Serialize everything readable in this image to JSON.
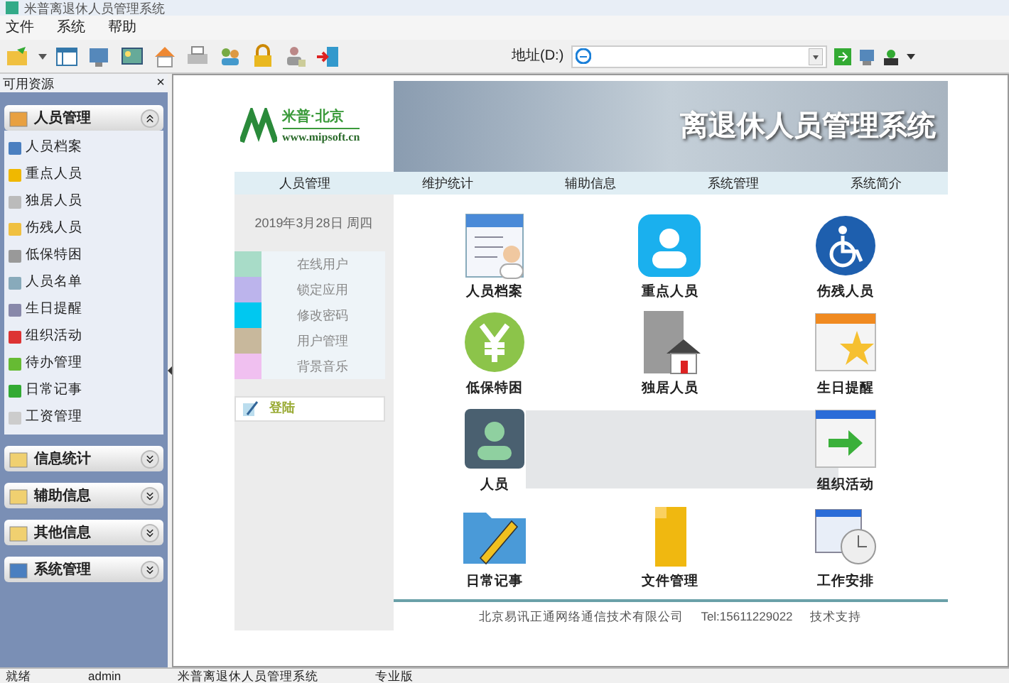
{
  "window": {
    "title": "米普离退休人员管理系统"
  },
  "menu": [
    "文件",
    "系统",
    "帮助"
  ],
  "address": {
    "label": "地址(D:)"
  },
  "sidebar": {
    "title": "可用资源",
    "close": "×",
    "groups": [
      {
        "label": "人员管理",
        "expanded": true,
        "items": [
          "人员档案",
          "重点人员",
          "独居人员",
          "伤残人员",
          "低保特困",
          "人员名单",
          "生日提醒",
          "组织活动",
          "待办管理",
          "日常记事",
          "工资管理"
        ]
      },
      {
        "label": "信息统计",
        "expanded": false
      },
      {
        "label": "辅助信息",
        "expanded": false
      },
      {
        "label": "其他信息",
        "expanded": false
      },
      {
        "label": "系统管理",
        "expanded": false
      }
    ]
  },
  "page": {
    "logo": {
      "name": "米普·北京",
      "url": "www.mipsoft.cn"
    },
    "banner_title": "离退休人员管理系统",
    "nav": [
      "人员管理",
      "维护统计",
      "辅助信息",
      "系统管理",
      "系统简介"
    ],
    "date": "2019年3月28日 周四",
    "quick_links": [
      {
        "label": "在线用户",
        "color": "#a8dcc8"
      },
      {
        "label": "锁定应用",
        "color": "#bcb4ec"
      },
      {
        "label": "修改密码",
        "color": "#00c8f0"
      },
      {
        "label": "用户管理",
        "color": "#c8b89c"
      },
      {
        "label": "背景音乐",
        "color": "#f0c0f0"
      }
    ],
    "login": "登陆",
    "tiles": [
      "人员档案",
      "重点人员",
      "伤残人员",
      "低保特困",
      "独居人员",
      "生日提醒",
      "人员",
      "组织活动",
      "日常记事",
      "文件管理",
      "工作安排"
    ],
    "footer": [
      "北京易讯正通网络通信技术有限公司",
      "Tel:15611229022",
      "技术支持"
    ]
  },
  "status_bar": [
    "就绪",
    "admin",
    "米普离退休人员管理系统",
    "专业版"
  ]
}
